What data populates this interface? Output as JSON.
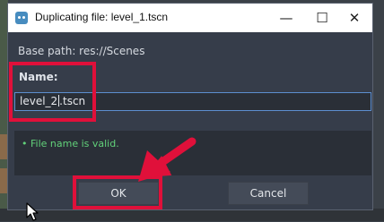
{
  "window": {
    "title": "Duplicating file: level_1.tscn",
    "minimize_glyph": "—",
    "maximize_glyph": "☐",
    "close_glyph": "✕"
  },
  "dialog": {
    "base_path": "Base path: res://Scenes",
    "name_label": "Name:",
    "name_value_before_caret": "level_2",
    "name_value_after_caret": ".tscn",
    "status_bullet": "•",
    "status_message": "File name is valid.",
    "ok_label": "OK",
    "cancel_label": "Cancel"
  },
  "colors": {
    "annotation": "#e0103a",
    "valid_status": "#62d27a",
    "input_focus_border": "#5d8fd0"
  },
  "icons": {
    "app": "godot-icon",
    "pointer": "mouse-pointer-icon",
    "annotation_arrow": "red-arrow-icon"
  }
}
